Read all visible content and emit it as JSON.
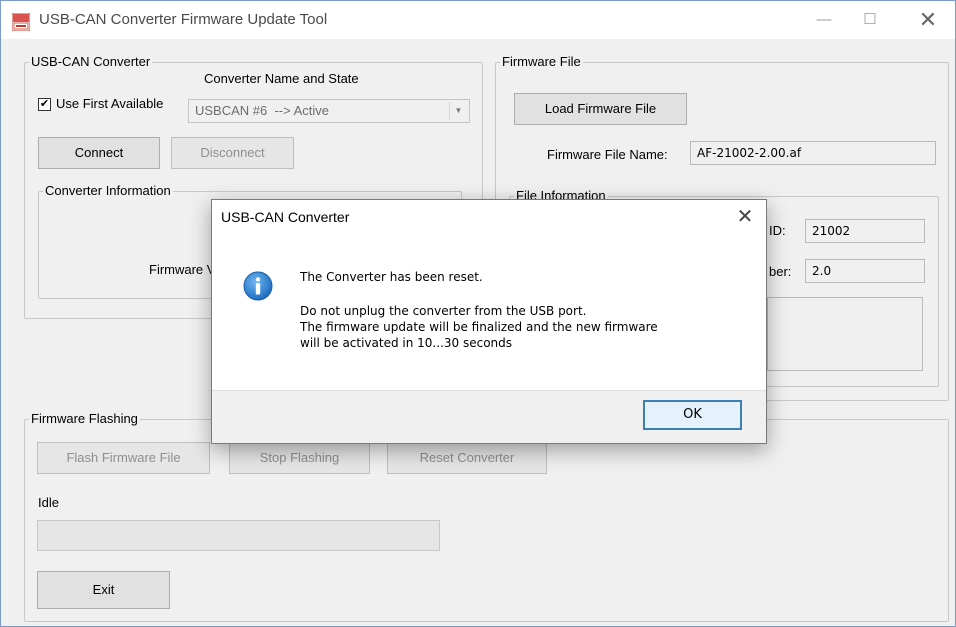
{
  "window": {
    "title": "USB-CAN Converter Firmware Update Tool",
    "minimize_glyph": "—",
    "maximize_glyph": "☐",
    "close_glyph": "✕"
  },
  "usb_can": {
    "group_label": "USB-CAN Converter",
    "column_header": "Converter Name and State",
    "use_first_label": "Use First Available",
    "use_first_checked": true,
    "check_glyph": "✔",
    "converter_value": "USBCAN #6  --> Active",
    "connect_label": "Connect",
    "disconnect_label": "Disconnect",
    "info_group_label": "Converter Information",
    "firmware_version_label": "Firmware Ve"
  },
  "firmware_file": {
    "group_label": "Firmware File",
    "load_label": "Load Firmware File",
    "name_label": "Firmware File Name:",
    "name_value": "AF-21002-2.00.af",
    "info_group_label": "File Information",
    "id_label": "ID:",
    "id_value": "21002",
    "version_label": "ber:",
    "version_value": "2.0"
  },
  "flashing": {
    "group_label": "Firmware Flashing",
    "flash_label": "Flash Firmware File",
    "stop_label": "Stop Flashing",
    "reset_label": "Reset Converter",
    "status_text": "Idle",
    "progress": 0
  },
  "exit_label": "Exit",
  "dialog": {
    "title": "USB-CAN Converter",
    "close_glyph": "✕",
    "line1": "The Converter has been reset.",
    "line2": "Do not unplug the converter from the USB port.",
    "line3": "The firmware update will be finalized and the new firmware",
    "line4": "will be activated in 10...30 seconds",
    "ok_label": "OK"
  },
  "colors": {
    "info_icon": "#1f6fc1",
    "dialog_ok_border": "#3c7fb1"
  }
}
